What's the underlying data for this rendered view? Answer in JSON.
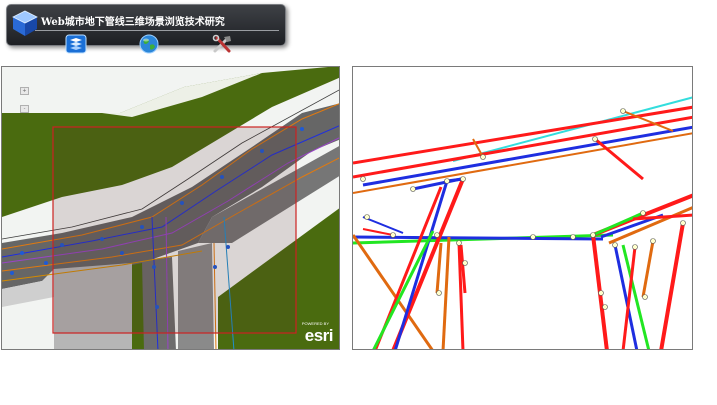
{
  "app": {
    "title": "Web城市地下管线三维场景浏览技术研究"
  },
  "toolbar": {
    "buttons": [
      {
        "name": "map-service-button",
        "icon": "layers-icon"
      },
      {
        "name": "globe-view-button",
        "icon": "globe-icon"
      },
      {
        "name": "tools-button",
        "icon": "hammer-wrench-icon"
      }
    ]
  },
  "map2d": {
    "attribution": "esri",
    "attribution_sub": "POWERED BY",
    "zoom_in": "+",
    "zoom_out": "-"
  },
  "colors": {
    "toolbar_bg": "#2b2d31",
    "vegetation": "#4a6b0f",
    "road": "#666666",
    "extent_box": "#cc2222",
    "pipe_red": "#ff1a1a",
    "pipe_blue": "#1e2ee0",
    "pipe_green": "#22e622",
    "pipe_orange": "#e06a10",
    "pipe_cyan": "#33dddd"
  }
}
